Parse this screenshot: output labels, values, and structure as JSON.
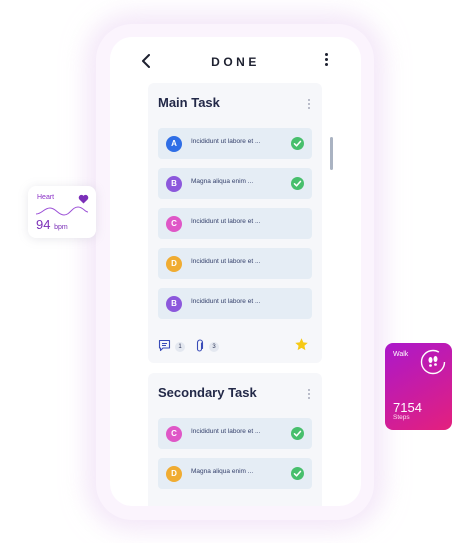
{
  "screen": {
    "title": "DONE"
  },
  "main_card": {
    "title": "Main Task",
    "tasks": [
      {
        "letter": "A",
        "text": "Incididunt ut labore et ...",
        "color": "#2f6ee6",
        "done": true
      },
      {
        "letter": "B",
        "text": "Magna aliqua enim ...",
        "color": "#8c58dc",
        "done": true
      },
      {
        "letter": "C",
        "text": "Incididunt ut labore et ...",
        "color": "#df57c7",
        "done": false
      },
      {
        "letter": "D",
        "text": "Incididunt ut labore et ...",
        "color": "#f0ac32",
        "done": false
      },
      {
        "letter": "B",
        "text": "Incididunt ut labore et ...",
        "color": "#8c58dc",
        "done": false
      }
    ],
    "comments_count": "1",
    "attachments_count": "3",
    "starred": true
  },
  "secondary_card": {
    "title": "Secondary Task",
    "tasks": [
      {
        "letter": "C",
        "text": "Incididunt ut labore et ...",
        "color": "#df57c7",
        "done": true
      },
      {
        "letter": "D",
        "text": "Magna aliqua enim ...",
        "color": "#f0ac32",
        "done": true
      }
    ]
  },
  "heart_widget": {
    "label": "Heart",
    "value": "94",
    "unit": "bpm",
    "color": "#7b2fb8"
  },
  "walk_widget": {
    "label": "Walk",
    "value": "7154",
    "unit": "Steps",
    "gradient": [
      "#ab18cb",
      "#e4207d"
    ]
  },
  "icons": {
    "back": "chevron-left-icon",
    "menu": "kebab-icon",
    "check": "check-circle-icon",
    "comment": "comment-icon",
    "attachment": "paperclip-icon",
    "star": "star-icon",
    "heart": "heart-icon",
    "footsteps": "footsteps-icon"
  },
  "colors": {
    "check": "#47bf6c",
    "star": "#f6c915",
    "task_bg": "#e5edf5",
    "card_bg": "#f6f7fa"
  }
}
